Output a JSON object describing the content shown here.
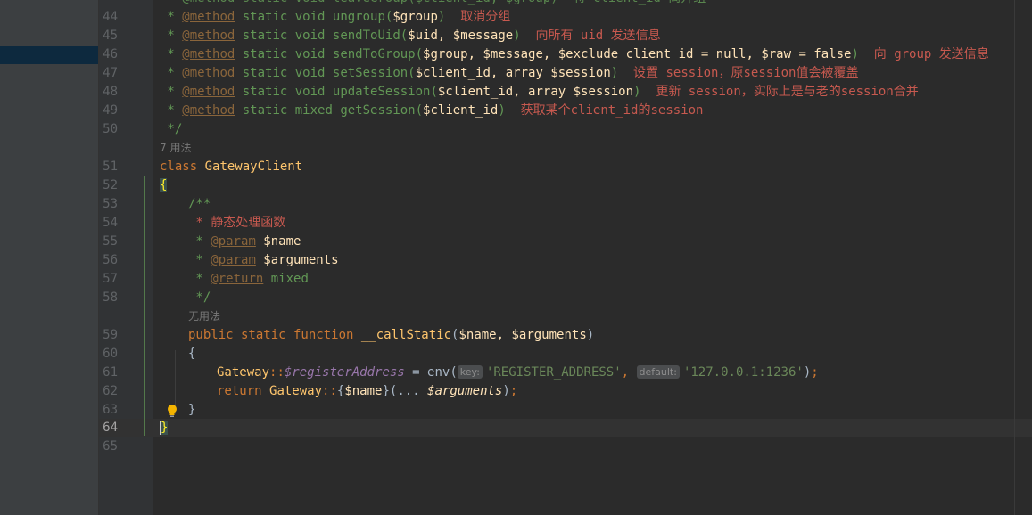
{
  "lines": [
    {
      "n": "44",
      "doc": " * ",
      "tag": "@method",
      "sig": " static void ungroup(",
      "params": "$group",
      "close": ")",
      "note": "  取消分组"
    },
    {
      "n": "45",
      "doc": " * ",
      "tag": "@method",
      "sig": " static void sendToUid(",
      "params": "$uid, $message",
      "close": ")",
      "note": "  向所有 uid 发送信息"
    },
    {
      "n": "46",
      "doc": " * ",
      "tag": "@method",
      "sig": " static void sendToGroup(",
      "params": "$group, $message, $exclude_client_id = null, $raw = false",
      "close": ")",
      "note": "  向 group 发送信息"
    },
    {
      "n": "47",
      "doc": " * ",
      "tag": "@method",
      "sig": " static void setSession(",
      "params": "$client_id, array $session",
      "close": ")",
      "note": "  设置 session，原session值会被覆盖"
    },
    {
      "n": "48",
      "doc": " * ",
      "tag": "@method",
      "sig": " static void updateSession(",
      "params": "$client_id, array $session",
      "close": ")",
      "note": "  更新 session，实际上是与老的session合并"
    },
    {
      "n": "49",
      "doc": " * ",
      "tag": "@method",
      "sig": " static mixed getSession(",
      "params": "$client_id",
      "close": ")",
      "note": "  获取某个client_id的session"
    }
  ],
  "top_partial": " * @method static void leaveGroup($client_id, $group)  将 client_id 离开组",
  "ln50": "50",
  "l50": " */",
  "hint_usages": "7 用法",
  "ln51": "51",
  "l51_kw": "class",
  "l51_name": "GatewayClient",
  "ln52": "52",
  "l52": "{",
  "ln53": "53",
  "l53": "/**",
  "ln54": "54",
  "l54": " * 静态处理函数",
  "ln55": "55",
  "l55_a": " * ",
  "l55_tag": "@param",
  "l55_b": " $name",
  "ln56": "56",
  "l56_a": " * ",
  "l56_tag": "@param",
  "l56_b": " $arguments",
  "ln57": "57",
  "l57_a": " * ",
  "l57_tag": "@return",
  "l57_b": " mixed",
  "ln58": "58",
  "l58": " */",
  "hint_no_usages": "无用法",
  "ln59": "59",
  "l59_kw": "public static function",
  "l59_fn": "__callStatic",
  "l59_params": "$name, $arguments",
  "ln60": "60",
  "l60": "{",
  "ln61": "61",
  "l61_cls": "Gateway",
  "l61_prop": "$registerAddress",
  "l61_fn": "env",
  "inlay_key": "key:",
  "l61_s1": "'REGISTER_ADDRESS'",
  "inlay_default": "default:",
  "l61_s2": "'127.0.0.1:1236'",
  "ln62": "62",
  "l62_kw": "return",
  "l62_cls": "Gateway",
  "l62_var": "$name",
  "l62_var2": "$arguments",
  "ln63": "63",
  "l63": "}",
  "ln64": "64",
  "l64": "}",
  "ln65": "65",
  "colors": {
    "keyword": "#cc7832",
    "doc": "#629755",
    "string": "#6a8759",
    "chinese": "#c7594f",
    "function": "#ffc66d",
    "field": "#9876aa"
  }
}
